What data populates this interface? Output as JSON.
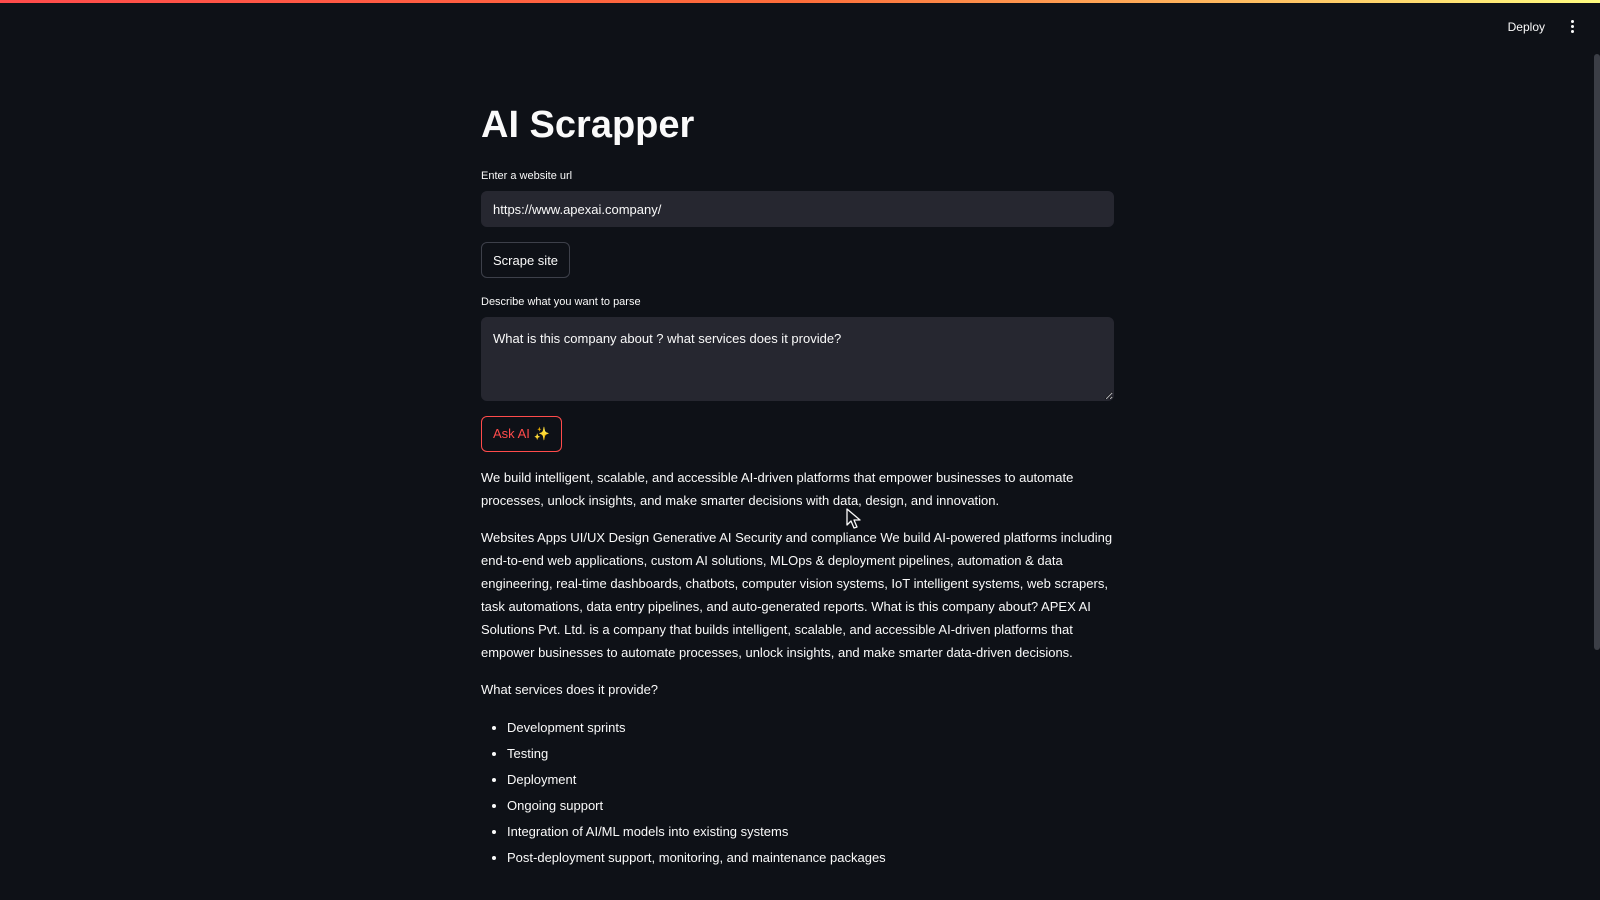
{
  "header": {
    "deploy_label": "Deploy",
    "menu_icon": "kebab-menu-icon"
  },
  "app": {
    "title": "AI Scrapper",
    "url_label": "Enter a website url",
    "url_value": "https://www.apexai.company/",
    "scrape_button": "Scrape site",
    "parse_label": "Describe what you want to parse",
    "parse_value": "What is this company about ? what services does it provide?",
    "ask_button": "Ask AI ✨"
  },
  "output": {
    "paragraph1": "We build intelligent, scalable, and accessible AI-driven platforms that empower businesses to automate processes, unlock insights, and make smarter decisions with data, design, and innovation.",
    "paragraph2": "Websites Apps UI/UX Design Generative AI Security and compliance We build AI-powered platforms including end-to-end web applications, custom AI solutions, MLOps & deployment pipelines, automation & data engineering, real-time dashboards, chatbots, computer vision systems, IoT intelligent systems, web scrapers, task automations, data entry pipelines, and auto-generated reports. What is this company about? APEX AI Solutions Pvt. Ltd. is a company that builds intelligent, scalable, and accessible AI-driven platforms that empower businesses to automate processes, unlock insights, and make smarter data-driven decisions.",
    "paragraph3": "What services does it provide?",
    "services": [
      "Development sprints",
      "Testing",
      "Deployment",
      "Ongoing support",
      "Integration of AI/ML models into existing systems",
      "Post-deployment support, monitoring, and maintenance packages"
    ]
  },
  "colors": {
    "background": "#0e1117",
    "input_bg": "#262730",
    "accent": "#ff4b4b"
  }
}
